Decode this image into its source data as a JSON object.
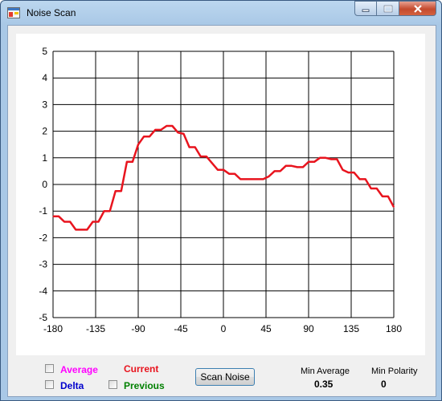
{
  "window": {
    "title": "Noise Scan",
    "controls": {
      "minimize": "minimize",
      "maximize": "maximize",
      "close": "close"
    }
  },
  "chart_data": {
    "type": "line",
    "title": "",
    "xlabel": "",
    "ylabel": "",
    "xlim": [
      -180,
      180
    ],
    "ylim": [
      -5,
      5
    ],
    "xticks": [
      "-180",
      "-135",
      "-90",
      "-45",
      "0",
      "45",
      "90",
      "135",
      "180"
    ],
    "yticks": [
      "5",
      "4",
      "3",
      "2",
      "1",
      "0",
      "-1",
      "-2",
      "-3",
      "-4",
      "-5"
    ],
    "grid": true,
    "series": [
      {
        "color": "#e8141e",
        "x": [
          -180,
          -174,
          -168,
          -162,
          -156,
          -150,
          -144,
          -138,
          -132,
          -126,
          -120,
          -114,
          -108,
          -102,
          -96,
          -90,
          -84,
          -78,
          -72,
          -66,
          -60,
          -54,
          -48,
          -42,
          -36,
          -30,
          -24,
          -18,
          -12,
          -6,
          0,
          6,
          12,
          18,
          24,
          30,
          36,
          42,
          48,
          54,
          60,
          66,
          72,
          78,
          84,
          90,
          96,
          102,
          108,
          114,
          120,
          126,
          132,
          138,
          144,
          150,
          156,
          162,
          168,
          174,
          180
        ],
        "y": [
          -1.2,
          -1.2,
          -1.4,
          -1.4,
          -1.7,
          -1.7,
          -1.7,
          -1.4,
          -1.4,
          -1.0,
          -1.0,
          -0.25,
          -0.25,
          0.85,
          0.85,
          1.5,
          1.8,
          1.8,
          2.05,
          2.05,
          2.2,
          2.2,
          1.95,
          1.9,
          1.4,
          1.4,
          1.05,
          1.05,
          0.8,
          0.55,
          0.55,
          0.4,
          0.4,
          0.2,
          0.2,
          0.2,
          0.2,
          0.2,
          0.3,
          0.5,
          0.5,
          0.7,
          0.7,
          0.65,
          0.65,
          0.85,
          0.85,
          1.0,
          1.0,
          0.95,
          0.95,
          0.55,
          0.45,
          0.45,
          0.2,
          0.2,
          -0.15,
          -0.15,
          -0.45,
          -0.45,
          -0.85
        ]
      }
    ]
  },
  "options": {
    "average": {
      "label": "Average",
      "color": "#ff00ff",
      "checked": false
    },
    "delta": {
      "label": "Delta",
      "color": "#0000cc",
      "checked": false
    },
    "current": {
      "label": "Current",
      "color": "#e8141e"
    },
    "previous": {
      "label": "Previous",
      "color": "#008000",
      "checked": false
    }
  },
  "scan_button": {
    "label": "Scan Noise"
  },
  "stats": {
    "min_average": {
      "label": "Min Average",
      "value": "0.35"
    },
    "min_polarity": {
      "label": "Min Polarity",
      "value": "0"
    }
  }
}
